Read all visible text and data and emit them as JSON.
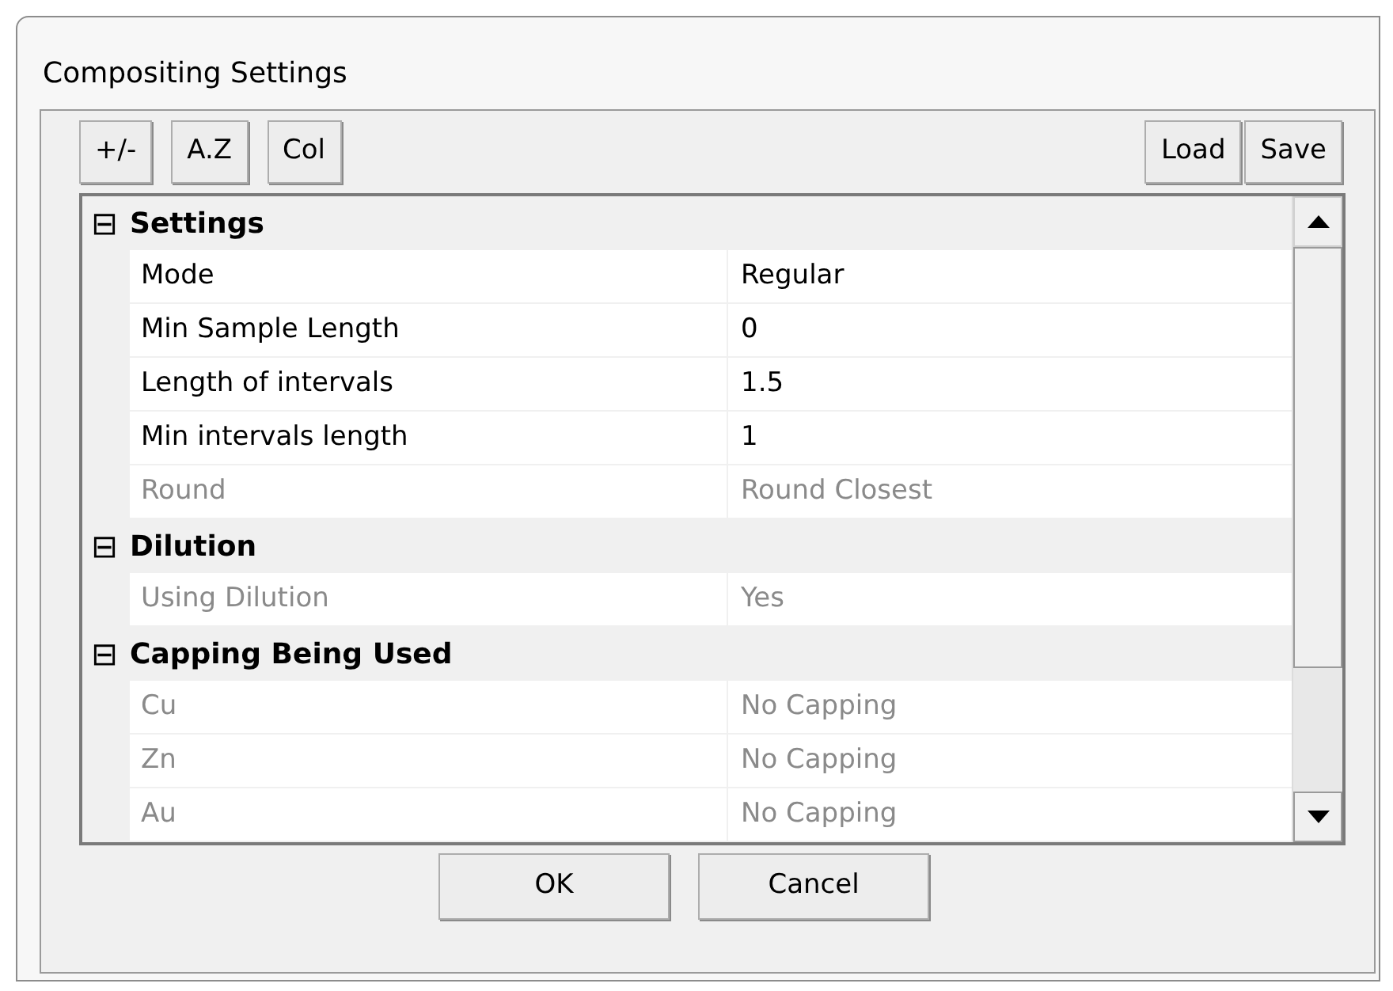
{
  "window": {
    "title": "Compositing Settings"
  },
  "toolbar_left": [
    "+/-",
    "A.Z",
    "Col"
  ],
  "toolbar_right": [
    "Load",
    "Save"
  ],
  "groups": [
    {
      "label": "Settings",
      "expanded": true,
      "icon": "⊟",
      "properties": [
        {
          "name": "Mode",
          "value": "Regular",
          "disabled": false
        },
        {
          "name": "Min Sample Length",
          "value": "0",
          "disabled": false
        },
        {
          "name": "Length of intervals",
          "value": "1.5",
          "disabled": false
        },
        {
          "name": "Min intervals length",
          "value": "1",
          "disabled": false
        },
        {
          "name": "Round",
          "value": "Round Closest",
          "disabled": true
        }
      ]
    },
    {
      "label": "Dilution",
      "expanded": true,
      "icon": "⊟",
      "properties": [
        {
          "name": "Using Dilution",
          "value": "Yes",
          "disabled": true
        }
      ]
    },
    {
      "label": "Capping Being Used",
      "expanded": true,
      "icon": "⊟",
      "properties": [
        {
          "name": "Cu",
          "value": "No Capping",
          "disabled": true
        },
        {
          "name": "Zn",
          "value": "No Capping",
          "disabled": true
        },
        {
          "name": "Au",
          "value": "No Capping",
          "disabled": true
        }
      ]
    }
  ],
  "buttons": [
    "OK",
    "Cancel"
  ]
}
